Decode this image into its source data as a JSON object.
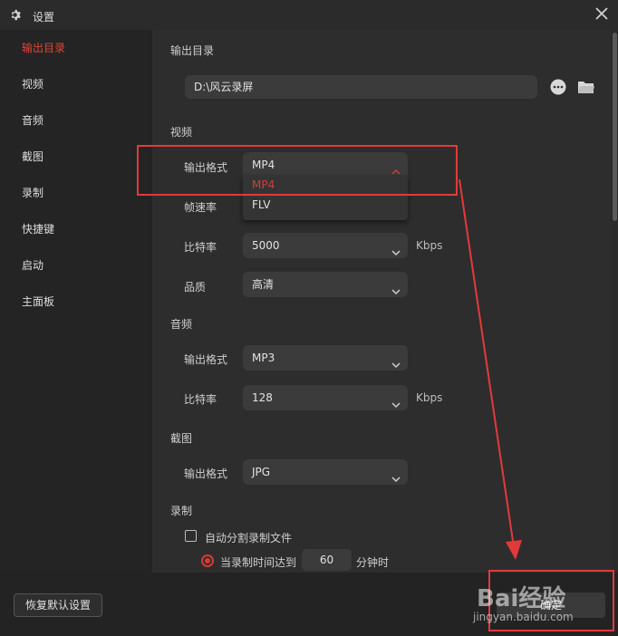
{
  "window": {
    "title": "设置",
    "title_icon": "gear-icon",
    "close_icon": "close-icon"
  },
  "sidebar": {
    "items": [
      {
        "label": "输出目录",
        "active": true
      },
      {
        "label": "视频",
        "active": false
      },
      {
        "label": "音频",
        "active": false
      },
      {
        "label": "截图",
        "active": false
      },
      {
        "label": "录制",
        "active": false
      },
      {
        "label": "快捷键",
        "active": false
      },
      {
        "label": "启动",
        "active": false
      },
      {
        "label": "主面板",
        "active": false
      }
    ]
  },
  "output_dir": {
    "section_title": "输出目录",
    "path": "D:\\风云录屏",
    "more_icon": "ellipsis-icon",
    "folder_icon": "folder-icon"
  },
  "video": {
    "section_title": "视频",
    "format_label": "输出格式",
    "format_value": "MP4",
    "format_options": [
      "MP4",
      "FLV"
    ],
    "framerate_label": "帧速率",
    "bitrate_label": "比特率",
    "bitrate_value": "5000",
    "bitrate_unit": "Kbps",
    "quality_label": "品质",
    "quality_value": "高清"
  },
  "audio": {
    "section_title": "音频",
    "format_label": "输出格式",
    "format_value": "MP3",
    "bitrate_label": "比特率",
    "bitrate_value": "128",
    "bitrate_unit": "Kbps"
  },
  "screenshot": {
    "section_title": "截图",
    "format_label": "输出格式",
    "format_value": "JPG"
  },
  "record": {
    "section_title": "录制",
    "auto_split_label": "自动分割录制文件",
    "auto_split_checked": false,
    "split_when_label": "当录制时间达到",
    "split_minutes": "60",
    "split_unit": "分钟时"
  },
  "footer": {
    "reset_label": "恢复默认设置",
    "ok_label": "确定"
  },
  "watermark": {
    "logo": "Bai经验",
    "url": "jingyan.baidu.com"
  },
  "colors": {
    "accent": "#e0453a",
    "annotation": "#e23a3a"
  }
}
